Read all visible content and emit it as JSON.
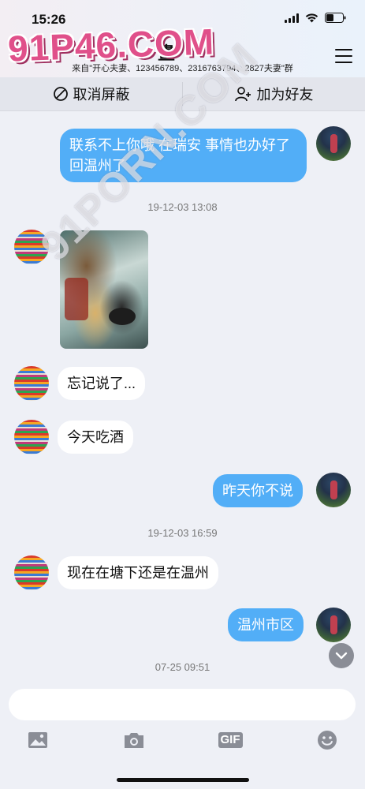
{
  "status_bar": {
    "time": "15:26"
  },
  "header": {
    "title": "畫",
    "subtitle": "来自\"开心夫妻、123456789、2316763794、2827夫妻\"群"
  },
  "actions": {
    "unblock_label": "取消屏蔽",
    "add_friend_label": "加为好友"
  },
  "messages": [
    {
      "side": "out",
      "text": "联系不上你哦 在瑞安 事情也办好了 回温州了"
    },
    {
      "type": "timestamp",
      "text": "19-12-03 13:08"
    },
    {
      "side": "in",
      "type": "image"
    },
    {
      "side": "in",
      "text": "忘记说了..."
    },
    {
      "side": "in",
      "text": "今天吃酒"
    },
    {
      "side": "out",
      "text": "昨天你不说"
    },
    {
      "type": "timestamp",
      "text": "19-12-03 16:59"
    },
    {
      "side": "in",
      "text": "现在在塘下还是在温州"
    },
    {
      "side": "out",
      "text": "温州市区"
    },
    {
      "type": "timestamp",
      "text": "07-25 09:51"
    }
  ],
  "input": {
    "placeholder": ""
  },
  "toolbar": {
    "icons": [
      "image-icon",
      "camera-icon",
      "gif-icon",
      "emoji-icon"
    ],
    "gif_label": "GIF"
  },
  "watermarks": {
    "top": "91P46.COM",
    "diagonal": "91PORN.COM"
  },
  "colors": {
    "outgoing_bubble": "#52aef7",
    "incoming_bubble": "#ffffff",
    "background": "#eef0f6"
  }
}
